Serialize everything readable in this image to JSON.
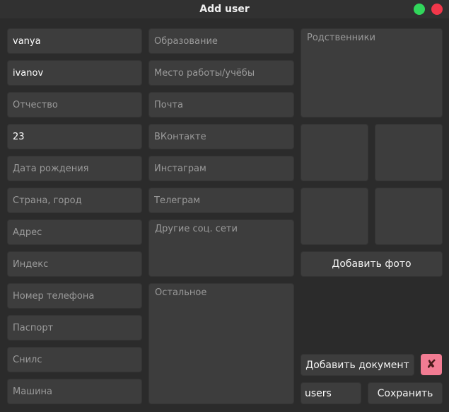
{
  "window": {
    "title": "Add user"
  },
  "left_column": [
    {
      "name": "first-name-field",
      "value": "vanya",
      "placeholder": ""
    },
    {
      "name": "last-name-field",
      "value": "ivanov",
      "placeholder": ""
    },
    {
      "name": "patronymic-field",
      "value": "",
      "placeholder": "Отчество"
    },
    {
      "name": "age-field",
      "value": "23",
      "placeholder": ""
    },
    {
      "name": "birth-date-field",
      "value": "",
      "placeholder": "Дата рождения"
    },
    {
      "name": "country-city-field",
      "value": "",
      "placeholder": "Страна, город"
    },
    {
      "name": "address-field",
      "value": "",
      "placeholder": "Адрес"
    },
    {
      "name": "postal-index-field",
      "value": "",
      "placeholder": "Индекс"
    },
    {
      "name": "phone-field",
      "value": "",
      "placeholder": "Номер телефона"
    },
    {
      "name": "passport-field",
      "value": "",
      "placeholder": "Паспорт"
    },
    {
      "name": "snils-field",
      "value": "",
      "placeholder": "Снилс"
    },
    {
      "name": "car-field",
      "value": "",
      "placeholder": "Машина"
    }
  ],
  "middle_column": [
    {
      "name": "education-field",
      "value": "",
      "placeholder": "Образование"
    },
    {
      "name": "workplace-field",
      "value": "",
      "placeholder": "Место работы/учёбы"
    },
    {
      "name": "email-field",
      "value": "",
      "placeholder": "Почта"
    },
    {
      "name": "vkontakte-field",
      "value": "",
      "placeholder": "ВКонтакте"
    },
    {
      "name": "instagram-field",
      "value": "",
      "placeholder": "Инстаграм"
    },
    {
      "name": "telegram-field",
      "value": "",
      "placeholder": "Телеграм"
    }
  ],
  "other_social": {
    "placeholder": "Другие соц. сети"
  },
  "other": {
    "placeholder": "Остальное"
  },
  "relatives": {
    "placeholder": "Родственники"
  },
  "buttons": {
    "add_photo": "Добавить фото",
    "add_document": "Добавить документ",
    "delete_document": "✘",
    "save": "Сохранить"
  },
  "table_field": {
    "value": "users",
    "placeholder": ""
  }
}
